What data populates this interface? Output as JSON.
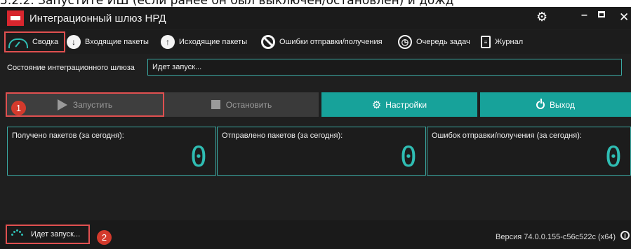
{
  "doc_header": {
    "text": "5.2.2. Запустите ИШ (если ранее он был выключен/остановлен) и дожд"
  },
  "window": {
    "title": "Интеграционный шлюз НРД",
    "controls": {
      "settings_icon": "gear-icon",
      "minimize": "minimize-icon",
      "maximize": "maximize-icon",
      "close": "close-icon"
    }
  },
  "tabs": [
    {
      "label": "Сводка",
      "icon": "gauge-icon",
      "active": true
    },
    {
      "label": "Входящие пакеты",
      "icon": "arrow-down-circle-icon"
    },
    {
      "label": "Исходящие пакеты",
      "icon": "arrow-up-circle-icon"
    },
    {
      "label": "Ошибки отправки/получения",
      "icon": "ban-icon"
    },
    {
      "label": "Очередь задач",
      "icon": "clock-icon"
    },
    {
      "label": "Журнал",
      "icon": "document-icon"
    }
  ],
  "status": {
    "label": "Состояние интеграционного шлюза",
    "value": "Идет запуск..."
  },
  "buttons": {
    "start": "Запустить",
    "stop": "Остановить",
    "settings": "Настройки",
    "exit": "Выход"
  },
  "counters": [
    {
      "label": "Получено пакетов (за сегодня):",
      "value": "0"
    },
    {
      "label": "Отправлено пакетов (за сегодня):",
      "value": "0"
    },
    {
      "label": "Ошибок отправки/получения (за сегодня):",
      "value": "0"
    }
  ],
  "footer": {
    "status_text": "Идет запуск...",
    "version": "Версия 74.0.0.155-c56c522c (x64)"
  },
  "annotations": {
    "badge1": "1",
    "badge2": "2"
  },
  "colors": {
    "accent": "#17a29a",
    "highlight": "#e05050",
    "badge": "#d33a2c",
    "background": "#1f1f1f"
  }
}
